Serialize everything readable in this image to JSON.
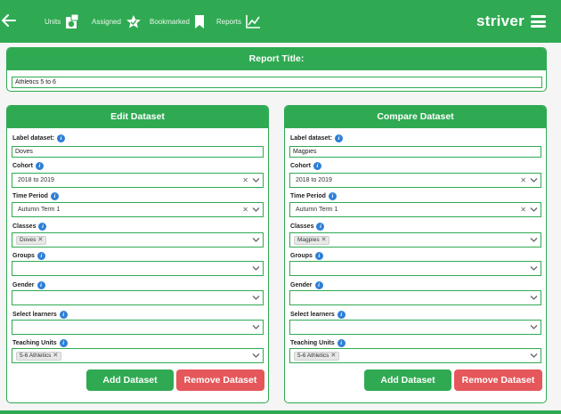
{
  "nav": {
    "items": [
      {
        "label": "Units",
        "icon": "units-icon"
      },
      {
        "label": "Assigned",
        "icon": "assigned-icon"
      },
      {
        "label": "Bookmarked",
        "icon": "bookmark-icon"
      },
      {
        "label": "Reports",
        "icon": "reports-chart-icon"
      }
    ],
    "logo": "striver"
  },
  "report": {
    "heading": "Report Title:",
    "title_value": "Athletics 5 to 6"
  },
  "edit": {
    "heading": "Edit Dataset",
    "label_dataset": "Label dataset:",
    "label_value": "Doves",
    "cohort_label": "Cohort",
    "cohort_value": "2018 to 2019",
    "period_label": "Time Period",
    "period_value": "Autumn Term 1",
    "classes_label": "Classes",
    "classes_tag": "Doves",
    "groups_label": "Groups",
    "gender_label": "Gender",
    "learners_label": "Select learners",
    "units_label": "Teaching Units",
    "units_tag": "5-6 Athletics",
    "add_label": "Add Dataset",
    "remove_label": "Remove Dataset"
  },
  "compare": {
    "heading": "Compare Dataset",
    "label_dataset": "Label dataset:",
    "label_value": "Magpies",
    "cohort_label": "Cohort",
    "cohort_value": "2018 to 2019",
    "period_label": "Time Period",
    "period_value": "Autumn Term 1",
    "classes_label": "Classes",
    "classes_tag": "Magpies",
    "groups_label": "Groups",
    "gender_label": "Gender",
    "learners_label": "Select learners",
    "units_label": "Teaching Units",
    "units_tag": "5-6 Athletics",
    "add_label": "Add Dataset",
    "remove_label": "Remove Dataset"
  },
  "colors": {
    "brand": "#2faa52",
    "danger": "#e5575a",
    "info": "#2f7fd6"
  }
}
